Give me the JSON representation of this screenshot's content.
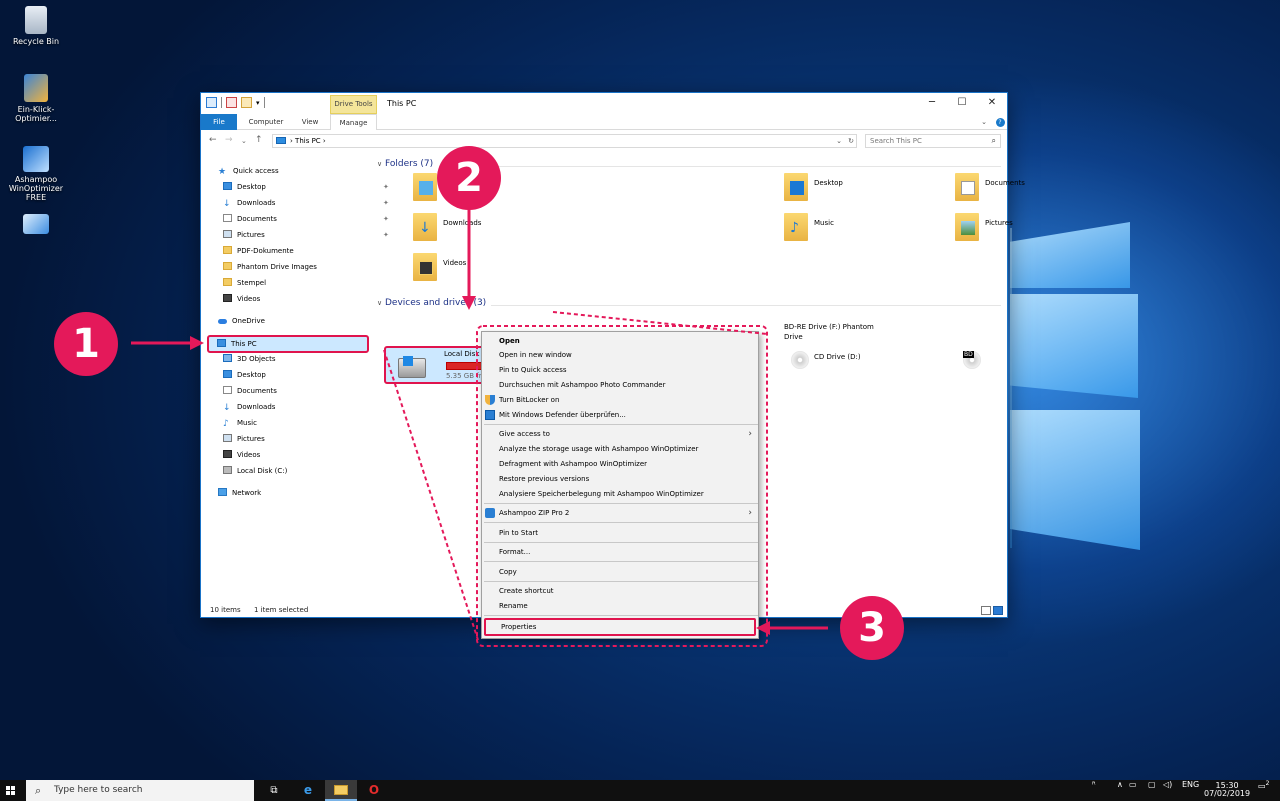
{
  "desktop": {
    "icons": [
      {
        "label": "Recycle Bin",
        "icon": "recycle-bin-icon"
      },
      {
        "label": "Ein-Klick-Optimier...",
        "icon": "optimizer-icon"
      },
      {
        "label": "Ashampoo WinOptimizer FREE",
        "icon": "winoptimizer-icon"
      },
      {
        "label": "",
        "icon": "control-panel-icon"
      }
    ]
  },
  "explorer": {
    "title": "This PC",
    "contextual_tab_group": "Drive Tools",
    "tabs": [
      "File",
      "Computer",
      "View",
      "Manage"
    ],
    "address": {
      "path_root": "This PC",
      "sep": "›"
    },
    "search_placeholder": "Search This PC",
    "nav": {
      "quick_access": "Quick access",
      "quick_items": [
        "Desktop",
        "Downloads",
        "Documents",
        "Pictures",
        "PDF-Dokumente",
        "Phantom Drive Images",
        "Stempel",
        "Videos"
      ],
      "onedrive": "OneDrive",
      "this_pc": "This PC",
      "pc_items": [
        "3D Objects",
        "Desktop",
        "Documents",
        "Downloads",
        "Music",
        "Pictures",
        "Videos",
        "Local Disk (C:)"
      ],
      "network": "Network"
    },
    "folders_header": "Folders (7)",
    "folders": [
      "Desktop",
      "Documents",
      "Downloads",
      "Music",
      "Pictures",
      "Videos"
    ],
    "devices_header": "Devices and drives (3)",
    "drives": {
      "c_name": "Local Disk (C:)",
      "c_free": "5.35 GB fre",
      "c_used_fraction": 0.93,
      "cd_name": "CD Drive (D:)",
      "bd_name_1": "BD-RE Drive (F:) Phantom",
      "bd_name_2": "Drive",
      "bd_badge": "BD"
    },
    "status": {
      "items": "10 items",
      "selected": "1 item selected"
    }
  },
  "context_menu": {
    "items": [
      {
        "label": "Open",
        "bold": true
      },
      {
        "label": "Open in new window"
      },
      {
        "label": "Pin to Quick access"
      },
      {
        "label": "Durchsuchen mit Ashampoo Photo Commander"
      },
      {
        "label": "Turn BitLocker on",
        "icon": "shield-icon"
      },
      {
        "label": "Mit Windows Defender überprüfen...",
        "icon": "defender-icon"
      },
      {
        "label": "Give access to",
        "submenu": true
      },
      {
        "label": "Analyze the storage usage with Ashampoo WinOptimizer"
      },
      {
        "label": "Defragment with Ashampoo WinOptimizer"
      },
      {
        "label": "Restore previous versions"
      },
      {
        "label": "Analysiere Speicherbelegung mit Ashampoo WinOptimizer"
      },
      {
        "label": "Ashampoo ZIP Pro 2",
        "icon": "zip-icon",
        "submenu": true
      },
      {
        "label": "Pin to Start"
      },
      {
        "label": "Format..."
      },
      {
        "label": "Copy"
      },
      {
        "label": "Create shortcut"
      },
      {
        "label": "Rename"
      },
      {
        "label": "Properties"
      }
    ]
  },
  "annotations": {
    "step1": "1",
    "step2": "2",
    "step3": "3",
    "color": "#e4195a"
  },
  "taskbar": {
    "search_placeholder": "Type here to search",
    "lang": "ENG",
    "time": "15:30",
    "date": "07/02/2019",
    "notification_count": "2"
  },
  "colors": {
    "accent": "#1979ca",
    "highlight": "#e0144e",
    "selection": "#cce8ff"
  }
}
